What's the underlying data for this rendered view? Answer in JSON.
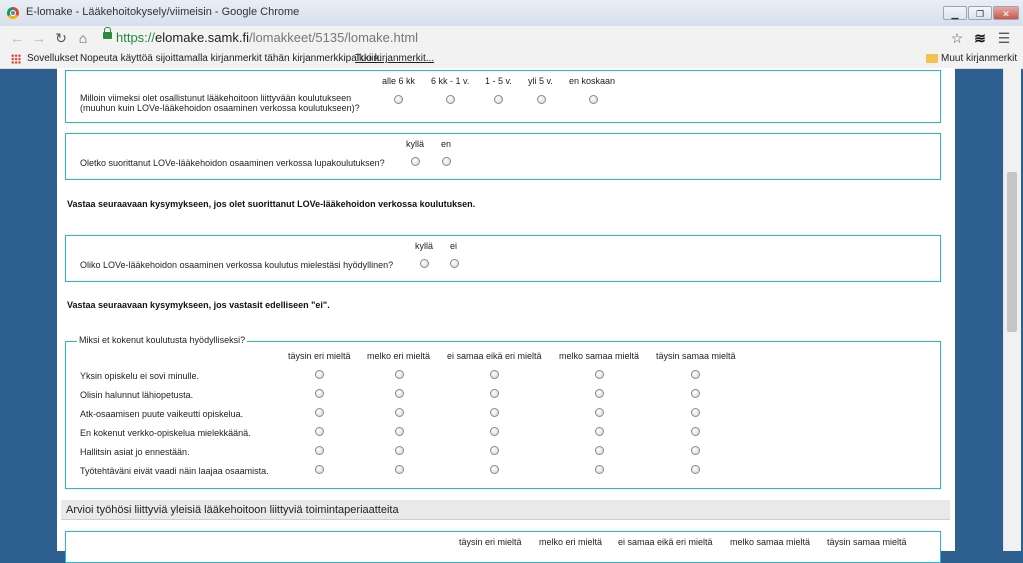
{
  "window": {
    "title": "E-lomake - Lääkehoitokysely/viimeisin - Google Chrome",
    "minimize": "▁",
    "maximize": "❐",
    "close": "✕"
  },
  "toolbar": {
    "back_icon": "←",
    "forward_icon": "→",
    "reload_icon": "↻",
    "home_icon": "⌂",
    "url_scheme": "https://",
    "url_host": "elomake.samk.fi",
    "url_path": "/lomakkeet/5135/lomake.html",
    "star_icon": "☆",
    "menu_icon": "☰"
  },
  "bookmarks": {
    "apps": "Sovellukset",
    "hint": "Nopeuta käyttöä sijoittamalla kirjanmerkit tähän kirjanmerkkipalkkiin.",
    "import": "Tuo kirjanmerkit...",
    "other": "Muut kirjanmerkit"
  },
  "q1": {
    "text_line1": "Milloin viimeksi olet osallistunut lääkehoitoon liittyvään koulutukseen",
    "text_line2": "(muuhun kuin LOVe-lääkehoidon osaaminen verkossa koulutukseen)?",
    "options": [
      "alle 6 kk",
      "6 kk - 1 v.",
      "1 - 5 v.",
      "yli 5 v.",
      "en koskaan"
    ]
  },
  "q2": {
    "text": "Oletko suorittanut LOVe-lääkehoidon osaaminen verkossa lupakoulutuksen?",
    "options": [
      "kyllä",
      "en"
    ]
  },
  "instruction1": "Vastaa seuraavaan kysymykseen, jos olet suorittanut LOVe-lääkehoidon verkossa koulutuksen.",
  "q3": {
    "text": "Oliko LOVe-lääkehoidon osaaminen verkossa koulutus mielestäsi hyödyllinen?",
    "options": [
      "kyllä",
      "ei"
    ]
  },
  "instruction2": "Vastaa seuraavaan kysymykseen, jos vastasit edelliseen \"ei\".",
  "q4": {
    "legend": "Miksi et kokenut koulutusta hyödylliseksi?",
    "scale": [
      "täysin eri mieltä",
      "melko eri mieltä",
      "ei samaa eikä eri mieltä",
      "melko samaa mieltä",
      "täysin samaa mieltä"
    ],
    "rows": [
      "Yksin opiskelu ei sovi minulle.",
      "Olisin halunnut lähiopetusta.",
      "Atk-osaamisen puute vaikeutti opiskelua.",
      "En kokenut verkko-opiskelua mielekkäänä.",
      "Hallitsin asiat jo ennestään.",
      "Työtehtäväni eivät vaadi näin laajaa osaamista."
    ]
  },
  "section2": {
    "title": "Arvioi työhösi liittyviä yleisiä lääkehoitoon liittyviä toimintaperiaatteita",
    "scale": [
      "täysin eri mieltä",
      "melko eri mieltä",
      "ei samaa eikä eri mieltä",
      "melko samaa mieltä",
      "täysin samaa mieltä"
    ]
  },
  "colors": {
    "frame_bg": "#2d5f8f",
    "box_border": "#29b6d6",
    "section_bg": "#e9e9e9"
  }
}
